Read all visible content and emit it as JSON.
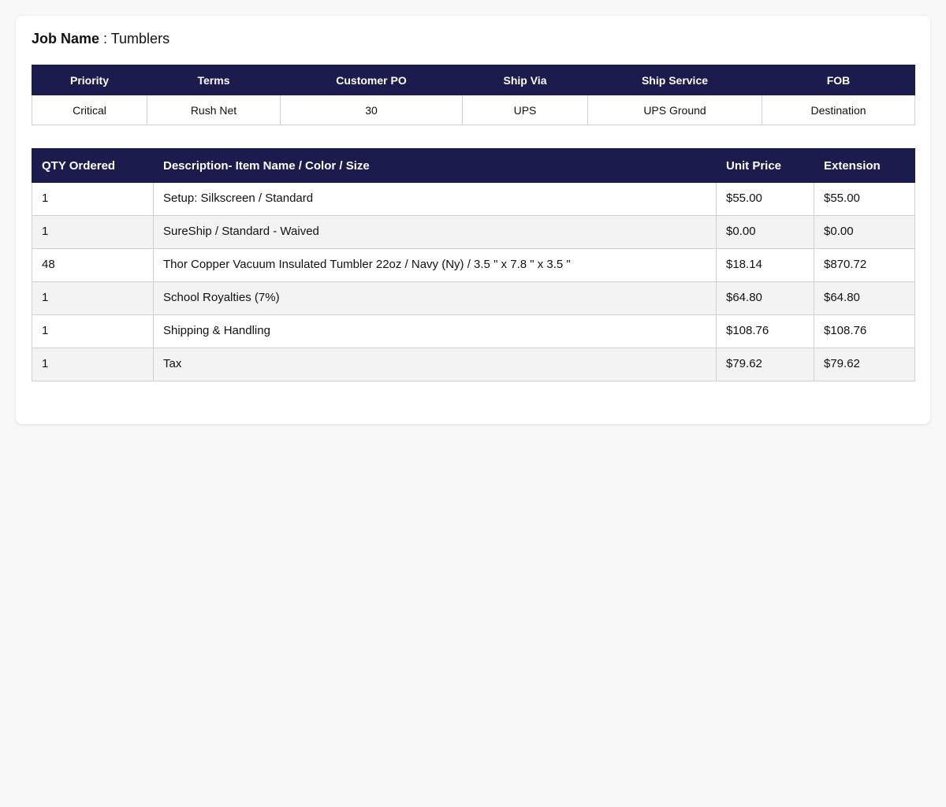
{
  "job": {
    "label": "Job Name",
    "separator": " : ",
    "value": "Tumblers"
  },
  "order_meta": {
    "headers": [
      "Priority",
      "Terms",
      "Customer PO",
      "Ship Via",
      "Ship Service",
      "FOB"
    ],
    "values": [
      "Critical",
      "Rush Net",
      "30",
      "UPS",
      "UPS Ground",
      "Destination"
    ]
  },
  "line_items": {
    "headers": [
      "QTY Ordered",
      "Description- Item Name / Color / Size",
      "Unit Price",
      "Extension"
    ],
    "rows": [
      {
        "qty": "1",
        "description": "Setup: Silkscreen / Standard",
        "unit_price": "$55.00",
        "extension": "$55.00"
      },
      {
        "qty": "1",
        "description": "SureShip / Standard - Waived",
        "unit_price": "$0.00",
        "extension": "$0.00"
      },
      {
        "qty": "48",
        "description": "Thor Copper Vacuum Insulated Tumbler 22oz / Navy (Ny) / 3.5 \" x 7.8 \" x 3.5 \"",
        "unit_price": "$18.14",
        "extension": "$870.72"
      },
      {
        "qty": "1",
        "description": "School Royalties (7%)",
        "unit_price": "$64.80",
        "extension": "$64.80"
      },
      {
        "qty": "1",
        "description": "Shipping & Handling",
        "unit_price": "$108.76",
        "extension": "$108.76"
      },
      {
        "qty": "1",
        "description": "Tax",
        "unit_price": "$79.62",
        "extension": "$79.62"
      }
    ]
  },
  "colors": {
    "header_bg": "#1c1b4d",
    "header_text": "#ffffff",
    "stripe_bg": "#f3f3f3"
  }
}
